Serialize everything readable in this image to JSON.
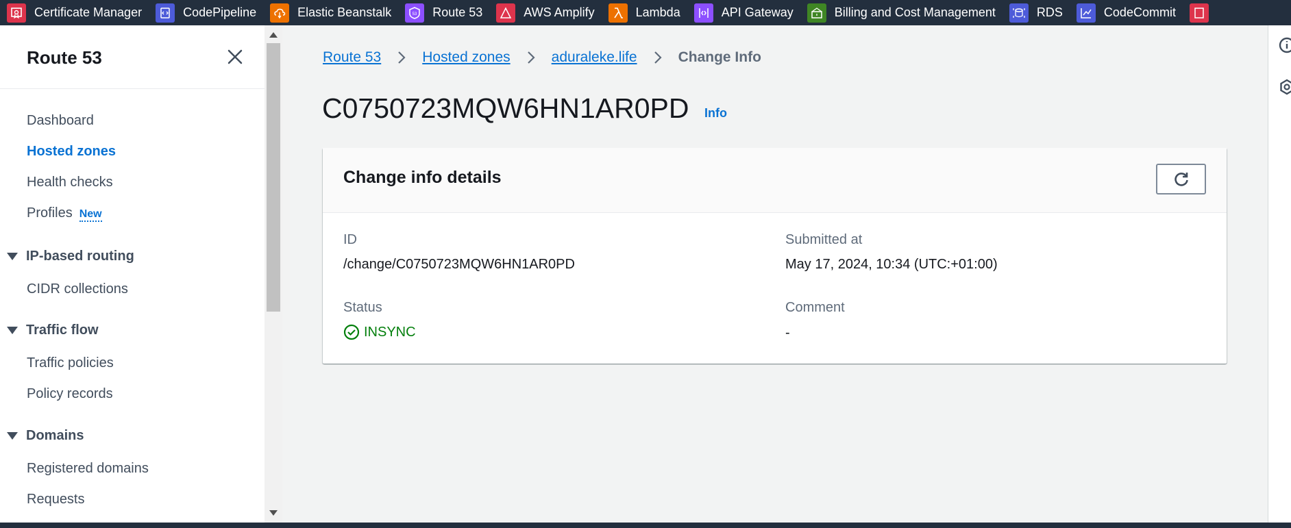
{
  "favorites": [
    {
      "label": "Certificate Manager",
      "icon": "certificate-icon",
      "color": "#dd344c"
    },
    {
      "label": "CodePipeline",
      "icon": "codepipeline-icon",
      "color": "#4d5bd9"
    },
    {
      "label": "Elastic Beanstalk",
      "icon": "beanstalk-icon",
      "color": "#ed7100"
    },
    {
      "label": "Route 53",
      "icon": "route53-icon",
      "color": "#8c4fff"
    },
    {
      "label": "AWS Amplify",
      "icon": "amplify-icon",
      "color": "#dd344c"
    },
    {
      "label": "Lambda",
      "icon": "lambda-icon",
      "color": "#ed7100"
    },
    {
      "label": "API Gateway",
      "icon": "apigateway-icon",
      "color": "#8c4fff"
    },
    {
      "label": "Billing and Cost Management",
      "icon": "billing-icon",
      "color": "#3f8624"
    },
    {
      "label": "RDS",
      "icon": "rds-icon",
      "color": "#4d5bd9"
    },
    {
      "label": "CodeCommit",
      "icon": "codecommit-icon",
      "color": "#4d5bd9"
    },
    {
      "label": "",
      "icon": "certificate-icon",
      "color": "#dd344c"
    }
  ],
  "sidebar": {
    "title": "Route 53",
    "items": [
      {
        "label": "Dashboard"
      },
      {
        "label": "Hosted zones",
        "active": true
      },
      {
        "label": "Health checks"
      },
      {
        "label": "Profiles",
        "badge": "New"
      }
    ],
    "sections": [
      {
        "label": "IP-based routing",
        "items": [
          "CIDR collections"
        ]
      },
      {
        "label": "Traffic flow",
        "items": [
          "Traffic policies",
          "Policy records"
        ]
      },
      {
        "label": "Domains",
        "items": [
          "Registered domains",
          "Requests"
        ]
      }
    ]
  },
  "breadcrumb": {
    "links": [
      "Route 53",
      "Hosted zones",
      "aduraleke.life"
    ],
    "current": "Change Info"
  },
  "page": {
    "title": "C0750723MQW6HN1AR0PD",
    "info_label": "Info"
  },
  "card": {
    "title": "Change info details",
    "id_label": "ID",
    "id_value": "/change/C0750723MQW6HN1AR0PD",
    "submitted_label": "Submitted at",
    "submitted_value": "May 17, 2024, 10:34 (UTC:+01:00)",
    "status_label": "Status",
    "status_value": "INSYNC",
    "comment_label": "Comment",
    "comment_value": "-"
  },
  "colors": {
    "link": "#0972d3",
    "success": "#037f0c",
    "topbar": "#232f3e"
  }
}
